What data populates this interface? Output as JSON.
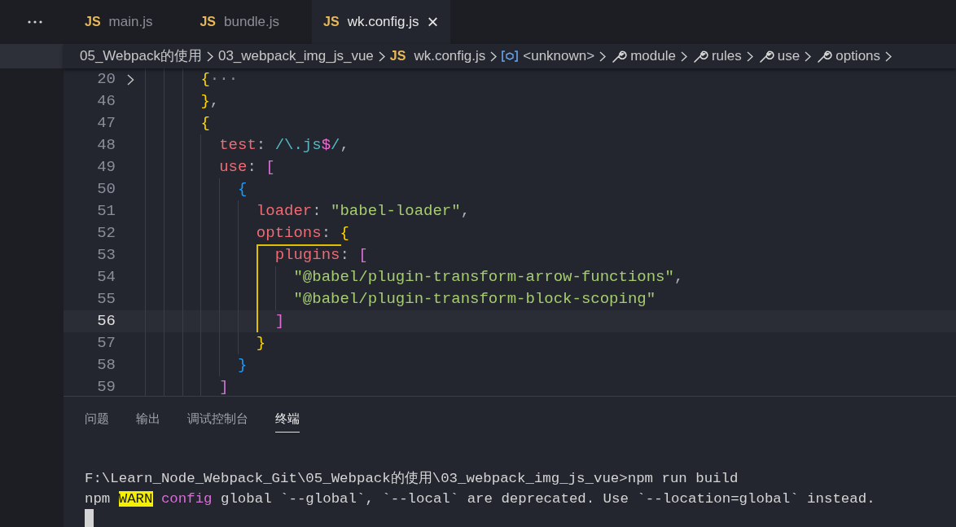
{
  "tabs": [
    {
      "label": "main.js",
      "badge": "JS",
      "selected": false
    },
    {
      "label": "bundle.js",
      "badge": "JS",
      "selected": false
    },
    {
      "label": "wk.config.js",
      "badge": "JS",
      "selected": true,
      "close": "×"
    }
  ],
  "breadcrumb": [
    {
      "kind": "folder",
      "label": "05_Webpack的使用"
    },
    {
      "kind": "folder",
      "label": "03_webpack_img_js_vue"
    },
    {
      "kind": "file",
      "badge": "JS",
      "label": "wk.config.js"
    },
    {
      "kind": "symbol",
      "label": "<unknown>"
    },
    {
      "kind": "property",
      "label": "module"
    },
    {
      "kind": "property",
      "label": "rules"
    },
    {
      "kind": "property",
      "label": "use"
    },
    {
      "kind": "property",
      "label": "options"
    }
  ],
  "code_lines": [
    {
      "number": "20",
      "folded": true,
      "current": false,
      "guide": false,
      "tokens": [
        {
          "text": "      {",
          "kind": "b1"
        },
        {
          "text": "···",
          "kind": "fold"
        }
      ]
    },
    {
      "number": "46",
      "folded": false,
      "current": false,
      "guide": false,
      "tokens": [
        {
          "text": "      }",
          "kind": "b1"
        },
        {
          "text": ",",
          "kind": "punct"
        }
      ]
    },
    {
      "number": "47",
      "folded": false,
      "current": false,
      "guide": false,
      "tokens": [
        {
          "text": "      {",
          "kind": "b1"
        }
      ]
    },
    {
      "number": "48",
      "folded": false,
      "current": false,
      "guide": false,
      "tokens": [
        {
          "text": "        test",
          "kind": "key"
        },
        {
          "text": ": ",
          "kind": "punct"
        },
        {
          "text": "/\\.js",
          "kind": "regex"
        },
        {
          "text": "$",
          "kind": "anchor"
        },
        {
          "text": "/",
          "kind": "regex"
        },
        {
          "text": ",",
          "kind": "punct"
        }
      ]
    },
    {
      "number": "49",
      "folded": false,
      "current": false,
      "guide": false,
      "tokens": [
        {
          "text": "        use",
          "kind": "key"
        },
        {
          "text": ": ",
          "kind": "punct"
        },
        {
          "text": "[",
          "kind": "b2"
        }
      ]
    },
    {
      "number": "50",
      "folded": false,
      "current": false,
      "guide": false,
      "tokens": [
        {
          "text": "          {",
          "kind": "b3"
        }
      ]
    },
    {
      "number": "51",
      "folded": false,
      "current": false,
      "guide": false,
      "tokens": [
        {
          "text": "            loader",
          "kind": "key"
        },
        {
          "text": ": ",
          "kind": "punct"
        },
        {
          "text": "\"babel-loader\"",
          "kind": "str"
        },
        {
          "text": ",",
          "kind": "punct"
        }
      ]
    },
    {
      "number": "52",
      "folded": false,
      "current": false,
      "guide": false,
      "tokens": [
        {
          "text": "            options",
          "kind": "key"
        },
        {
          "text": ": ",
          "kind": "punct"
        },
        {
          "text": "{",
          "kind": "b1"
        }
      ]
    },
    {
      "number": "53",
      "folded": false,
      "current": false,
      "guide": true,
      "tokens": [
        {
          "text": "              plugins",
          "kind": "key"
        },
        {
          "text": ": ",
          "kind": "punct"
        },
        {
          "text": "[",
          "kind": "b2"
        }
      ]
    },
    {
      "number": "54",
      "folded": false,
      "current": false,
      "guide": true,
      "tokens": [
        {
          "text": "                \"@babel/plugin-transform-arrow-functions\"",
          "kind": "str"
        },
        {
          "text": ",",
          "kind": "punct"
        }
      ]
    },
    {
      "number": "55",
      "folded": false,
      "current": false,
      "guide": true,
      "tokens": [
        {
          "text": "                \"@babel/plugin-transform-block-scoping\"",
          "kind": "str"
        }
      ]
    },
    {
      "number": "56",
      "folded": false,
      "current": true,
      "guide": true,
      "tokens": [
        {
          "text": "              ]",
          "kind": "b2"
        }
      ]
    },
    {
      "number": "57",
      "folded": false,
      "current": false,
      "guide": false,
      "tokens": [
        {
          "text": "            }",
          "kind": "b1"
        }
      ]
    },
    {
      "number": "58",
      "folded": false,
      "current": false,
      "guide": false,
      "tokens": [
        {
          "text": "          }",
          "kind": "b3"
        }
      ]
    },
    {
      "number": "59",
      "folded": false,
      "current": false,
      "guide": false,
      "tokens": [
        {
          "text": "        ]",
          "kind": "b2"
        }
      ]
    }
  ],
  "panel_tabs": [
    {
      "label": "问题",
      "selected": false
    },
    {
      "label": "输出",
      "selected": false
    },
    {
      "label": "调试控制台",
      "selected": false
    },
    {
      "label": "终端",
      "selected": true
    }
  ],
  "terminal_lines": [
    [
      {
        "text": "F:\\Learn_Node_Webpack_Git\\05_Webpack的使用\\03_webpack_img_js_vue>npm run build",
        "kind": "plain"
      }
    ],
    [
      {
        "text": "npm",
        "kind": "plain"
      },
      {
        "text": "WARN",
        "kind": "warn"
      },
      {
        "text": "config",
        "kind": "config"
      },
      {
        "text": "global `--global`, `--local` are deprecated. Use `--location=global` instead.",
        "kind": "plain"
      }
    ]
  ]
}
